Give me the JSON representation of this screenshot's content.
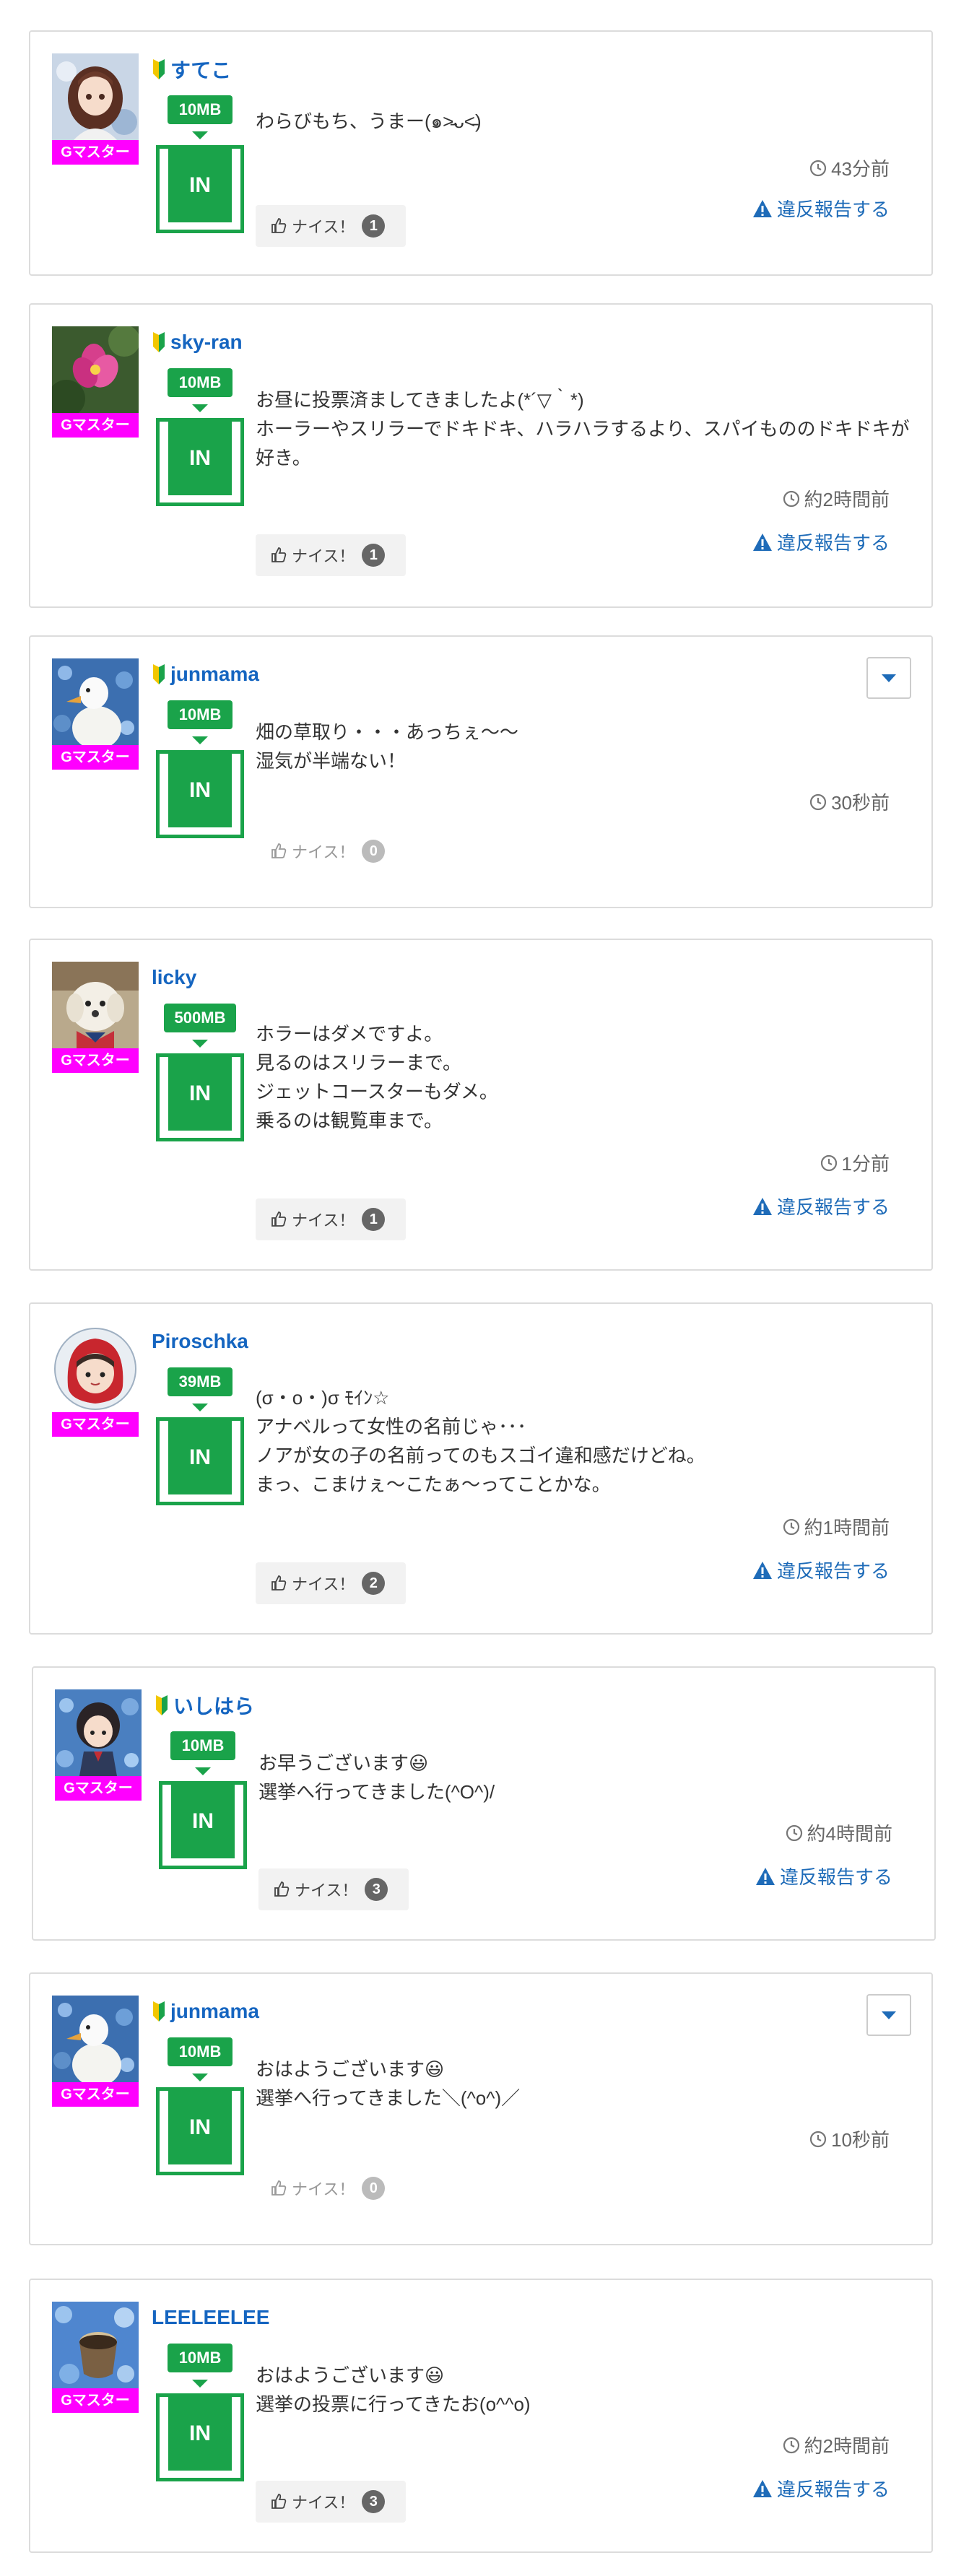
{
  "colors": {
    "rank_badge": "#ff00ff",
    "storage_green": "#1aa34a",
    "name_blue": "#1565c0",
    "report_blue": "#1e6bb8"
  },
  "posts": [
    {
      "user": {
        "name": "すてこ",
        "beginner_icon": "beginner-leaf-icon",
        "avatar": "anime-girl-avatar",
        "rank": "Gマスター"
      },
      "storage": "10MB",
      "in_label": "IN",
      "message": [
        "わらびもち、うまー(๑˃̵ᴗ˂̵)"
      ],
      "time": "43分前",
      "nice": {
        "label": "ナイス！",
        "count": "1"
      },
      "report": "違反報告する"
    },
    {
      "user": {
        "name": "sky-ran",
        "beginner_icon": "beginner-leaf-icon",
        "avatar": "pink-flower-avatar",
        "rank": "Gマスター"
      },
      "storage": "10MB",
      "in_label": "IN",
      "message": [
        "お昼に投票済ましてきましたよ(*´▽｀*)",
        "ホーラーやスリラーでドキドキ、ハラハラするより、スパイもののドキドキが好き。"
      ],
      "time": "約2時間前",
      "nice": {
        "label": "ナイス！",
        "count": "1"
      },
      "report": "違反報告する"
    },
    {
      "user": {
        "name": "junmama",
        "beginner_icon": "beginner-leaf-icon",
        "avatar": "white-duck-avatar",
        "rank": "Gマスター"
      },
      "storage": "10MB",
      "in_label": "IN",
      "message": [
        "畑の草取り・・・あっちぇ〜〜",
        "湿気が半端ない！"
      ],
      "time": "30秒前",
      "nice": {
        "label": "ナイス！",
        "count": "0"
      },
      "menu_icon": "caret-down-icon"
    },
    {
      "user": {
        "name": "licky",
        "avatar": "white-dog-avatar",
        "rank": "Gマスター"
      },
      "storage": "500MB",
      "in_label": "IN",
      "message": [
        "ホラーはダメですよ。",
        "見るのはスリラーまで。",
        "ジェットコースターもダメ。",
        "乗るのは観覧車まで。"
      ],
      "time": "1分前",
      "nice": {
        "label": "ナイス！",
        "count": "1"
      },
      "report": "違反報告する"
    },
    {
      "user": {
        "name": "Piroschka",
        "avatar": "red-hood-girl-avatar",
        "rank": "Gマスター"
      },
      "storage": "39MB",
      "in_label": "IN",
      "message": [
        "(σ・o・)σ ﾓｲﾝ☆",
        "アナベルって女性の名前じゃ･･･",
        "ノアが女の子の名前ってのもスゴイ違和感だけどね。",
        "まっ、こまけぇ〜こたぁ〜ってことかな。"
      ],
      "time": "約1時間前",
      "nice": {
        "label": "ナイス！",
        "count": "2"
      },
      "report": "違反報告する"
    },
    {
      "user": {
        "name": "いしはら",
        "beginner_icon": "beginner-leaf-icon",
        "avatar": "dark-hair-boy-avatar",
        "rank": "Gマスター"
      },
      "storage": "10MB",
      "in_label": "IN",
      "message": [
        "お早うございます😃",
        "選挙へ行ってきました(^O^)/"
      ],
      "time": "約4時間前",
      "nice": {
        "label": "ナイス！",
        "count": "3"
      },
      "report": "違反報告する"
    },
    {
      "user": {
        "name": "junmama",
        "beginner_icon": "beginner-leaf-icon",
        "avatar": "white-duck-avatar",
        "rank": "Gマスター"
      },
      "storage": "10MB",
      "in_label": "IN",
      "message": [
        "おはようございます😃",
        "選挙へ行ってきました＼(^o^)／"
      ],
      "time": "10秒前",
      "nice": {
        "label": "ナイス！",
        "count": "0"
      },
      "menu_icon": "caret-down-icon"
    },
    {
      "user": {
        "name": "LEELEELEE",
        "avatar": "blue-flower-cup-avatar",
        "rank": "Gマスター"
      },
      "storage": "10MB",
      "in_label": "IN",
      "message": [
        "おはようございます😃",
        "選挙の投票に行ってきたお(o^^o)"
      ],
      "time": "約2時間前",
      "nice": {
        "label": "ナイス！",
        "count": "3"
      },
      "report": "違反報告する"
    }
  ]
}
